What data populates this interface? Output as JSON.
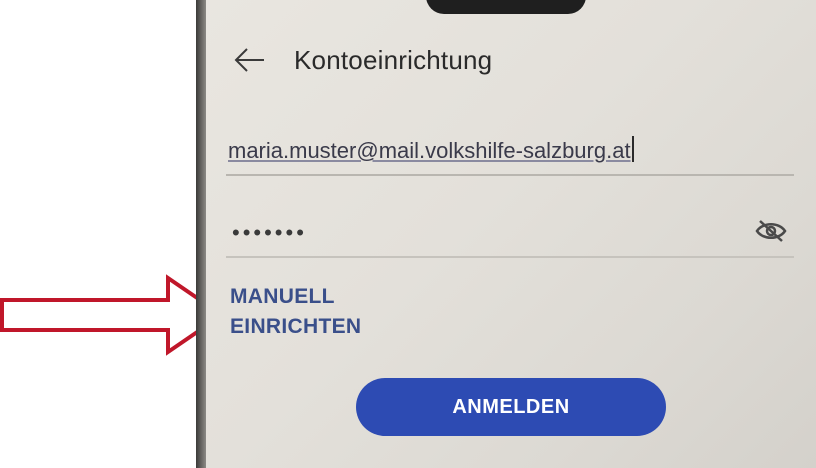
{
  "header": {
    "title": "Kontoeinrichtung",
    "back_icon": "arrow-left-icon"
  },
  "form": {
    "email_value": "maria.muster@mail.volkshilfe-salzburg.at",
    "password_value": "•••••••",
    "password_toggle_icon": "eye-off-icon"
  },
  "links": {
    "manual_setup_line1": "MANUELL",
    "manual_setup_line2": "EINRICHTEN"
  },
  "buttons": {
    "login_label": "ANMELDEN"
  },
  "colors": {
    "accent": "#2d4bb3",
    "link": "#3a4f8a",
    "annotation_arrow": "#c0172a"
  }
}
